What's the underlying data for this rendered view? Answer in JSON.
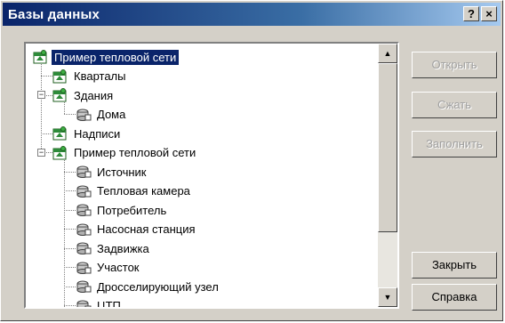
{
  "window": {
    "title": "Базы данных",
    "help_glyph": "?",
    "close_glyph": "×"
  },
  "tree": {
    "items": [
      {
        "label": "Пример тепловой сети",
        "icon": "database-icon",
        "selected": true
      },
      {
        "label": "Кварталы",
        "icon": "table-icon"
      },
      {
        "label": "Здания",
        "icon": "table-icon",
        "expander": "−"
      },
      {
        "label": "Дома",
        "icon": "object-type-icon"
      },
      {
        "label": "Надписи",
        "icon": "table-icon"
      },
      {
        "label": "Пример тепловой сети",
        "icon": "table-icon",
        "expander": "−"
      },
      {
        "label": "Источник",
        "icon": "object-type-icon"
      },
      {
        "label": "Тепловая камера",
        "icon": "object-type-icon"
      },
      {
        "label": "Потребитель",
        "icon": "object-type-icon"
      },
      {
        "label": "Насосная станция",
        "icon": "object-type-icon"
      },
      {
        "label": "Задвижка",
        "icon": "object-type-icon"
      },
      {
        "label": "Участок",
        "icon": "object-type-icon"
      },
      {
        "label": "Дросселирующий узел",
        "icon": "object-type-icon"
      },
      {
        "label": "ЦТП",
        "icon": "object-type-icon"
      }
    ]
  },
  "scrollbar": {
    "up_glyph": "▲",
    "down_glyph": "▼"
  },
  "buttons": {
    "open": "Открыть",
    "compress": "Сжать",
    "fill": "Заполнить",
    "close": "Закрыть",
    "help": "Справка"
  },
  "colors": {
    "selection": "#0a246a",
    "title_start": "#0a246a",
    "title_end": "#a6caf0",
    "face": "#d4d0c8",
    "table_icon": "#2e8b3a"
  }
}
